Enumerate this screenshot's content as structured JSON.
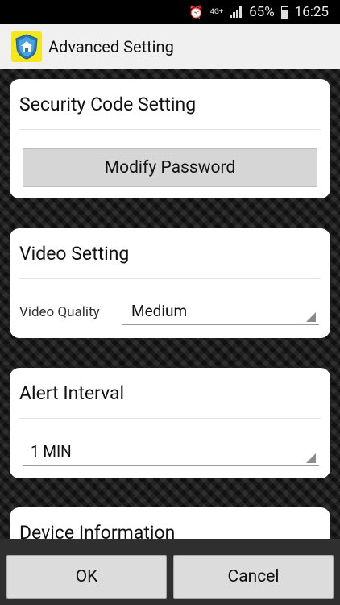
{
  "status_bar": {
    "alarm_icon": "alarm-clock-icon",
    "network_type": "4G+",
    "signal_icon": "cell-signal-icon",
    "battery_percent": "65%",
    "battery_icon": "battery-icon",
    "time": "16:25"
  },
  "title_bar": {
    "app_icon": "shield-house-icon",
    "title": "Advanced Setting"
  },
  "security": {
    "header": "Security Code Setting",
    "modify_button": "Modify Password"
  },
  "video": {
    "header": "Video Setting",
    "quality_label": "Video Quality",
    "quality_value": "Medium"
  },
  "alert": {
    "header": "Alert Interval",
    "interval_value": "1 MIN"
  },
  "device": {
    "header": "Device Information"
  },
  "footer": {
    "ok_label": "OK",
    "cancel_label": "Cancel"
  },
  "colors": {
    "app_icon_bg": "#f3e61c",
    "title_bar_bg": "#f0f0f0",
    "footer_bg": "#2f2f2f",
    "button_bg": "#d6d6d6"
  }
}
